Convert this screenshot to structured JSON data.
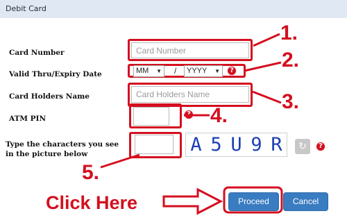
{
  "header": {
    "title": "Debit Card"
  },
  "fields": {
    "card_number": {
      "label": "Card Number",
      "placeholder": "Card Number"
    },
    "expiry": {
      "label": "Valid Thru/Expiry Date",
      "month": "MM",
      "separator": "/",
      "year": "YYYY"
    },
    "holder_name": {
      "label": "Card Holders Name",
      "placeholder": "Card Holders Name"
    },
    "atm_pin": {
      "label": "ATM PIN"
    },
    "captcha": {
      "label": "Type the characters you see in the picture below",
      "characters": [
        "A",
        "5",
        "U",
        "9",
        "R"
      ]
    }
  },
  "annotations": {
    "n1": "1.",
    "n2": "2.",
    "n3": "3.",
    "n4": "4.",
    "n5": "5.",
    "click_here": "Click Here"
  },
  "icons": {
    "help": "question-circle-icon",
    "refresh": "refresh-icon",
    "arrow": "arrow-right-icon"
  },
  "help_glyph": "?",
  "refresh_glyph": "↻",
  "buttons": {
    "proceed": "Proceed",
    "cancel": "Cancel"
  },
  "colors": {
    "accent": "#3a7cc1",
    "annotation": "#d40f1f",
    "header_bg": "#dfe8f3"
  }
}
